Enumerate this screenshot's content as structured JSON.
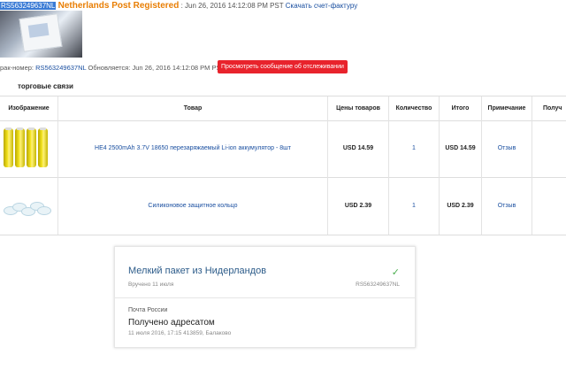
{
  "header": {
    "tracking_number": "RS563249637NL",
    "carrier_status": "Netherlands Post Registered",
    "timestamp": " : Jun 26, 2016 14:12:08 PM PST",
    "invoice_link": "Скачать счет-фактуру"
  },
  "tracking": {
    "label": "рак-номер:",
    "number": "RS563249637NL",
    "updated": "Обновляется: Jun 26, 2016 14:12:08 PM PST",
    "view_message_button": "Просмотреть сообщение об отслеживании"
  },
  "section_title": "торговые связи",
  "table": {
    "headers": [
      "Изображение",
      "Товар",
      "Цены товаров",
      "Количество",
      "Итого",
      "Примечание",
      "Получ"
    ],
    "rows": [
      {
        "product": "HE4 2500mAh 3.7V 18650 перезаряжаемый Li-ion аккумулятор - 8шт",
        "price": "USD 14.59",
        "qty": "1",
        "total": "USD 14.59",
        "note": "Отзыв"
      },
      {
        "product": "Силиконовое защитное кольцо",
        "price": "USD 2.39",
        "qty": "1",
        "total": "USD 2.39",
        "note": "Отзыв"
      }
    ]
  },
  "card": {
    "title": "Мелкий пакет из Нидерландов",
    "check_icon": "✓",
    "subtitle": "Вручено 11 июля",
    "tracking_number": "RS563249637NL",
    "carrier": "Почта России",
    "status": "Получено адресатом",
    "detail": "11 июля 2016, 17:15 413859, Балаково"
  },
  "colors": {
    "accent_orange": "#e87e04",
    "link_blue": "#1a4fa0",
    "button_red": "#e8232c",
    "check_green": "#4caf50"
  }
}
